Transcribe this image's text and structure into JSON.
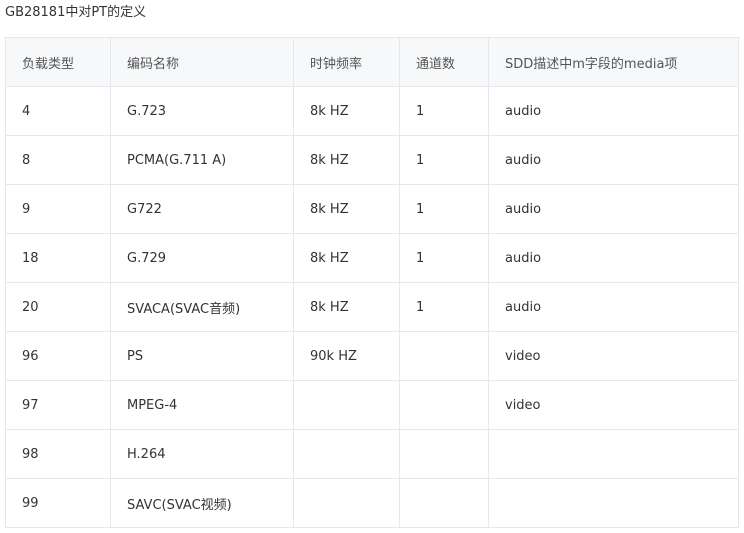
{
  "caption": "GB28181中对PT的定义",
  "table": {
    "headers": [
      "负载类型",
      "编码名称",
      "时钟频率",
      "通道数",
      "SDD描述中m字段的media项"
    ],
    "rows": [
      [
        "4",
        "G.723",
        "8k HZ",
        "1",
        "audio"
      ],
      [
        "8",
        "PCMA(G.711 A)",
        "8k HZ",
        "1",
        "audio"
      ],
      [
        "9",
        "G722",
        "8k HZ",
        "1",
        "audio"
      ],
      [
        "18",
        "G.729",
        "8k HZ",
        "1",
        "audio"
      ],
      [
        "20",
        "SVACA(SVAC音频)",
        "8k HZ",
        "1",
        "audio"
      ],
      [
        "96",
        "PS",
        "90k HZ",
        "",
        "video"
      ],
      [
        "97",
        "MPEG-4",
        "",
        "",
        "video"
      ],
      [
        "98",
        "H.264",
        "",
        "",
        ""
      ],
      [
        "99",
        "SAVC(SVAC视频)",
        "",
        "",
        ""
      ]
    ]
  }
}
